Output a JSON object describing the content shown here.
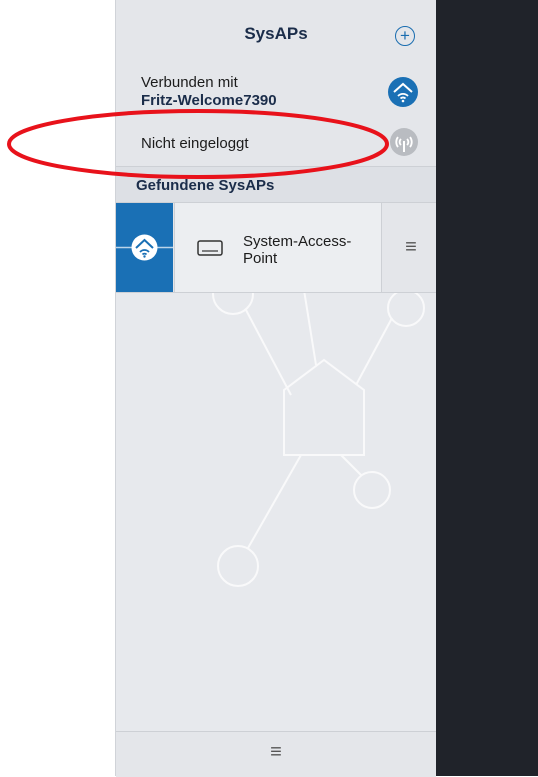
{
  "header": {
    "title": "SysAPs",
    "add_icon": "plus-circle-icon"
  },
  "connection": {
    "label": "Verbunden mit",
    "network": "Fritz-Welcome7390",
    "icon": "wifi-house-icon",
    "icon_color": "#1a70b5"
  },
  "login": {
    "status": "Nicht eingeloggt",
    "icon": "antenna-icon"
  },
  "section": {
    "title": "Gefundene SysAPs"
  },
  "sysaps": [
    {
      "name": "System-Access-Point",
      "name_line1": "System-Access-",
      "name_line2": "Point",
      "status_icon": "wifi-house-icon",
      "device_icon": "device-icon",
      "menu_icon": "hamburger-icon"
    }
  ],
  "footer": {
    "menu_icon": "hamburger-icon"
  },
  "annotation": {
    "color": "#e8121b",
    "shape": "ellipse"
  },
  "colors": {
    "accent": "#1a70b5",
    "panel_bg": "#e7e9ed",
    "dark_area": "#20232a"
  }
}
